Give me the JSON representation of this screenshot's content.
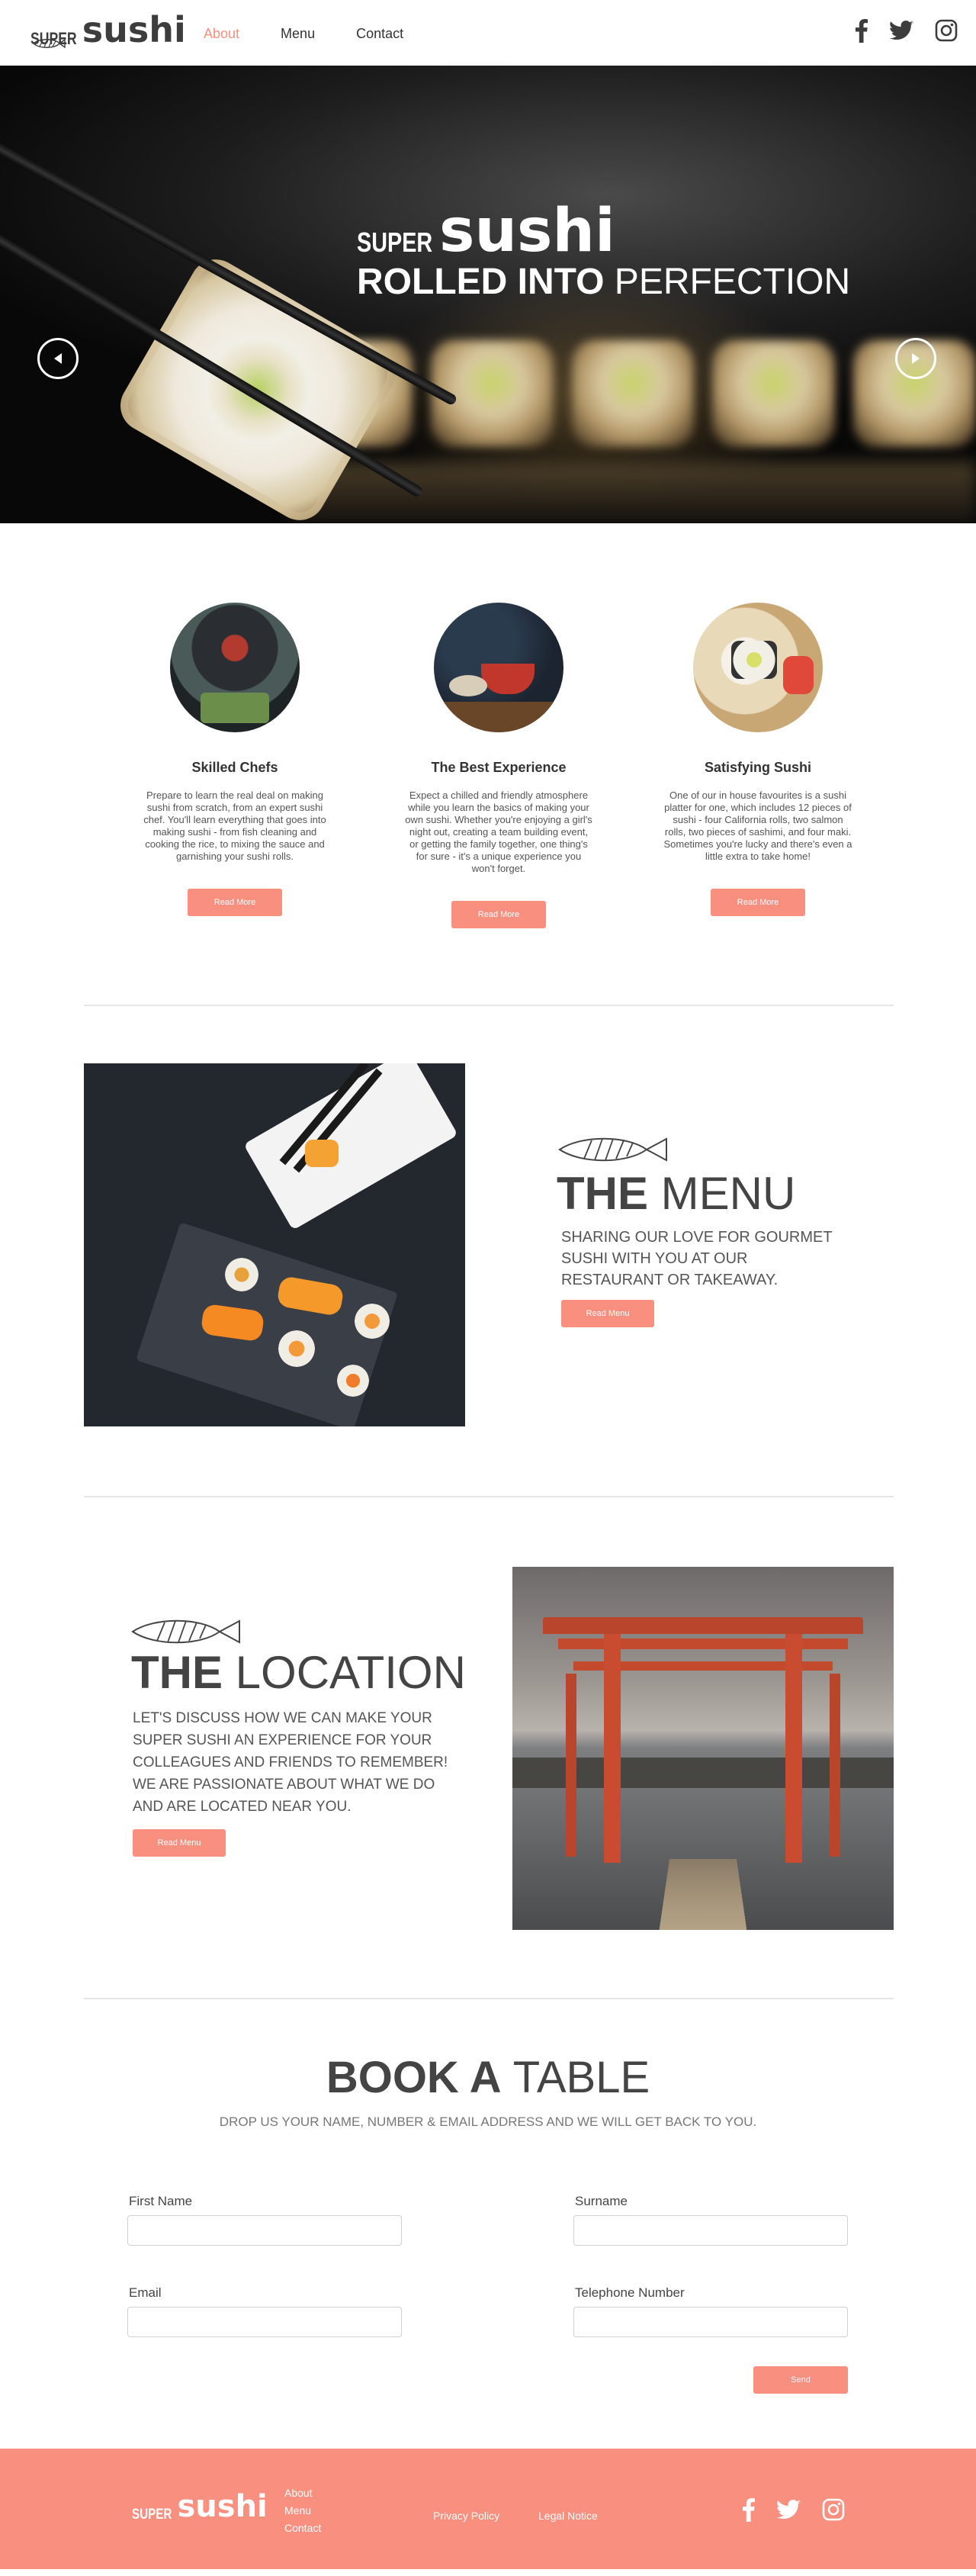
{
  "header": {
    "logo": {
      "super": "SUPER",
      "sushi": "sushi"
    },
    "nav": [
      "About",
      "Menu",
      "Contact"
    ],
    "active_nav": "About",
    "social": [
      "facebook-icon",
      "twitter-icon",
      "instagram-icon"
    ]
  },
  "hero": {
    "brand_super": "SUPER",
    "brand_sushi": "sushi",
    "tagline_bold": "ROLLED INTO",
    "tagline_light": "PERFECTION"
  },
  "features": [
    {
      "title": "Skilled Chefs",
      "text": "Prepare to learn the real deal on making sushi from scratch, from an expert sushi chef. You'll learn everything that goes into making sushi - from fish cleaning and cooking the rice, to mixing the sauce and garnishing your sushi rolls.",
      "button": "Read More"
    },
    {
      "title": "The Best Experience",
      "text": "Expect a chilled and friendly atmosphere while you learn the basics of making your own sushi. Whether you're enjoying a girl's night out, creating a team building event, or getting the family together, one thing's for sure - it's a unique experience you won't forget.",
      "button": "Read More"
    },
    {
      "title": "Satisfying Sushi",
      "text": "One of our in house favourites is a sushi platter for one, which includes 12 pieces of sushi - four California rolls, two salmon rolls, two pieces of sashimi, and four maki. Sometimes you're lucky and there's even a little extra to take home!",
      "button": "Read More"
    }
  ],
  "menu": {
    "title_bold": "THE",
    "title_light": "MENU",
    "subtitle": "SHARING OUR LOVE FOR GOURMET SUSHI WITH YOU AT OUR RESTAURANT OR TAKEAWAY.",
    "button": "Read Menu"
  },
  "location": {
    "title_bold": "THE",
    "title_light": "LOCATION",
    "subtitle": "LET'S DISCUSS HOW WE CAN MAKE YOUR SUPER SUSHI AN EXPERIENCE FOR YOUR COLLEAGUES AND FRIENDS TO REMEMBER! WE ARE PASSIONATE ABOUT WHAT WE DO AND ARE LOCATED NEAR YOU.",
    "button": "Read Menu"
  },
  "book": {
    "title_bold": "BOOK A",
    "title_light": "TABLE",
    "subtitle": "DROP US YOUR NAME, NUMBER & EMAIL ADDRESS AND WE WILL GET BACK TO YOU.",
    "fields": {
      "first_name": {
        "label": "First Name",
        "value": ""
      },
      "surname": {
        "label": "Surname",
        "value": ""
      },
      "email": {
        "label": "Email",
        "value": ""
      },
      "telephone": {
        "label": "Telephone Number",
        "value": ""
      }
    },
    "send": "Send"
  },
  "footer": {
    "logo": {
      "super": "SUPER",
      "sushi": "sushi"
    },
    "nav": [
      "About",
      "Menu",
      "Contact"
    ],
    "privacy": "Privacy Policy",
    "legal": "Legal Notice",
    "social": [
      "facebook-icon",
      "twitter-icon",
      "instagram-icon"
    ]
  },
  "colors": {
    "accent": "#f98f7f",
    "text": "#444444",
    "divider": "#e6e6e6"
  }
}
